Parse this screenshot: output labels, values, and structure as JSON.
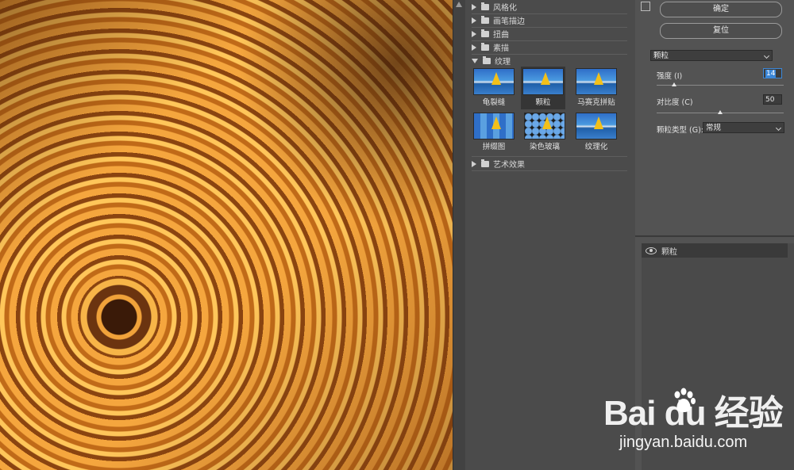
{
  "gallery": {
    "categories_top": [
      {
        "label": "风格化"
      },
      {
        "label": "画笔描边"
      },
      {
        "label": "扭曲"
      },
      {
        "label": "素描"
      }
    ],
    "open_category": "纹理",
    "thumbnails": [
      {
        "label": "龟裂缝"
      },
      {
        "label": "颗粒"
      },
      {
        "label": "马赛克拼贴"
      },
      {
        "label": "拼缀图"
      },
      {
        "label": "染色玻璃"
      },
      {
        "label": "纹理化"
      }
    ],
    "categories_bottom": [
      {
        "label": "艺术效果"
      }
    ]
  },
  "settings": {
    "ok_label": "确定",
    "reset_label": "复位",
    "filter_select": "颗粒",
    "params": {
      "intensity_label": "强度 (I)",
      "intensity_value": "14",
      "contrast_label": "对比度 (C)",
      "contrast_value": "50",
      "grain_type_label": "颗粒类型 (G):",
      "grain_type_value": "常规"
    },
    "slider_levels": {
      "intensity": 0.14,
      "contrast": 0.5
    }
  },
  "layers": {
    "items": [
      {
        "name": "颗粒"
      }
    ]
  },
  "watermark": {
    "logo": "Bai du 经验",
    "url": "jingyan.baidu.com"
  },
  "colors": {
    "selection_blue": "#3b87d8",
    "panel_bg": "#535353"
  }
}
